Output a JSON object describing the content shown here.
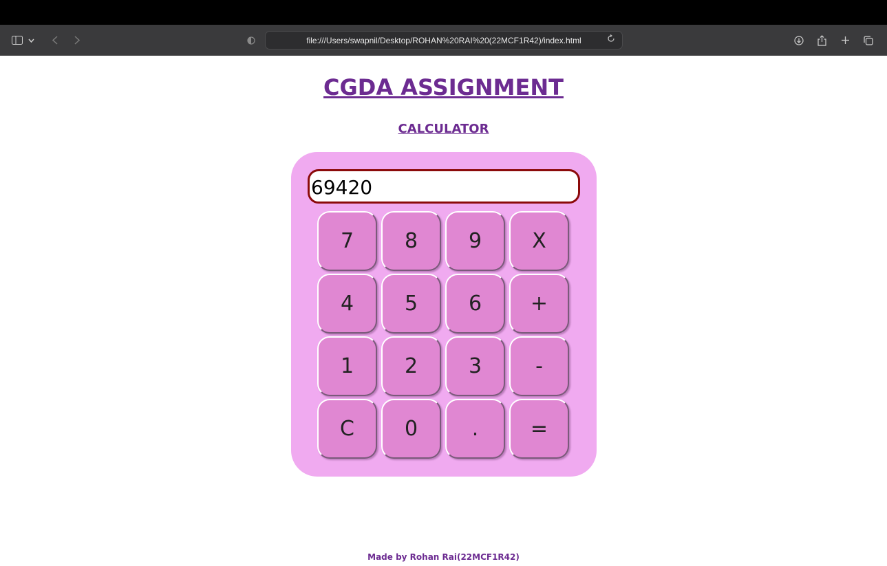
{
  "browser": {
    "url": "file:///Users/swapnil/Desktop/ROHAN%20RAI%20(22MCF1R42)/index.html",
    "icons": {
      "sidebar": "sidebar-icon",
      "chevron": "chevron-down-icon",
      "back": "back-icon",
      "forward": "forward-icon",
      "privacy": "privacy-shield-icon",
      "reload": "reload-icon",
      "download": "download-icon",
      "share": "share-icon",
      "new_tab": "plus-icon",
      "tabs": "tabs-overview-icon"
    }
  },
  "page": {
    "title": "CGDA ASSIGNMENT",
    "subtitle": "CALCULATOR",
    "footer": "Made by Rohan Rai(22MCF1R42)"
  },
  "calculator": {
    "display_value": "69420",
    "rows": [
      [
        "7",
        "8",
        "9",
        "X"
      ],
      [
        "4",
        "5",
        "6",
        "+"
      ],
      [
        "1",
        "2",
        "3",
        "-"
      ],
      [
        "C",
        "0",
        ".",
        "="
      ]
    ]
  },
  "colors": {
    "heading": "#6c2b91",
    "calc_body": "#f0aaf0",
    "key": "#e087d2",
    "display_border": "#8b0a0a"
  }
}
